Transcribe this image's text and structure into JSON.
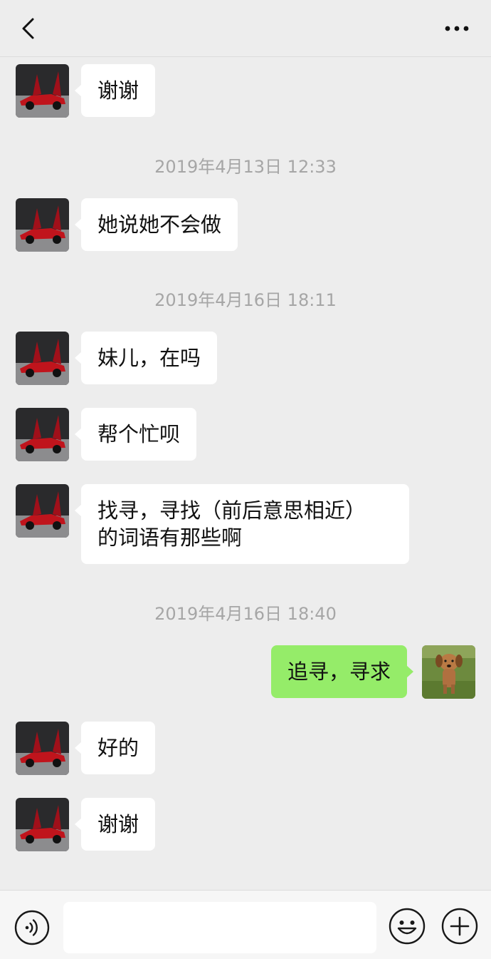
{
  "header": {
    "title": "",
    "back_icon": "chevron-left-icon",
    "more_icon": "more-dots-icon"
  },
  "contacts": {
    "other_avatar": "red-sports-car-avatar",
    "self_avatar": "dog-avatar"
  },
  "messages": [
    {
      "type": "text",
      "side": "left",
      "text": "谢谢"
    },
    {
      "type": "timestamp",
      "text": "2019年4月13日 12:33"
    },
    {
      "type": "text",
      "side": "left",
      "text": "她说她不会做"
    },
    {
      "type": "timestamp",
      "text": "2019年4月16日 18:11"
    },
    {
      "type": "text",
      "side": "left",
      "text": "妹儿，在吗"
    },
    {
      "type": "text",
      "side": "left",
      "text": "帮个忙呗"
    },
    {
      "type": "text",
      "side": "left",
      "lines": [
        "找寻，寻找（前后意思相近）",
        "的词语有那些啊"
      ]
    },
    {
      "type": "timestamp",
      "text": "2019年4月16日 18:40"
    },
    {
      "type": "text",
      "side": "right",
      "text": "追寻，寻求"
    },
    {
      "type": "text",
      "side": "left",
      "text": "好的"
    },
    {
      "type": "text",
      "side": "left",
      "text": "谢谢"
    }
  ],
  "composer": {
    "input_value": "",
    "voice_icon": "voice-icon",
    "emoji_icon": "emoji-icon",
    "plus_icon": "plus-circle-icon"
  },
  "colors": {
    "background": "#ededed",
    "bubble_other": "#ffffff",
    "bubble_self": "#95ec69",
    "timestamp": "#a6a6a6"
  }
}
